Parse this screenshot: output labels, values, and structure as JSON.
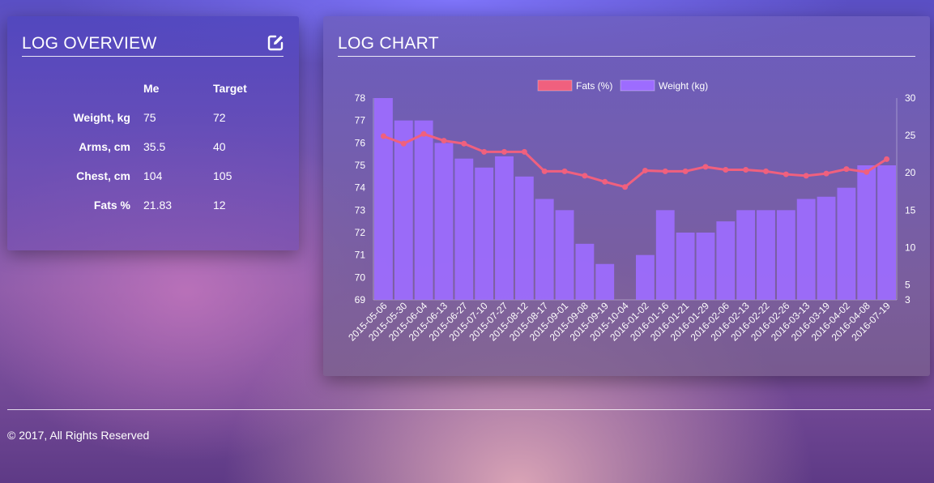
{
  "overview": {
    "title": "LOG OVERVIEW",
    "edit_icon": "edit-icon",
    "col_me": "Me",
    "col_target": "Target",
    "rows": [
      {
        "label": "Weight, kg",
        "me": "75",
        "target": "72"
      },
      {
        "label": "Arms, cm",
        "me": "35.5",
        "target": "40"
      },
      {
        "label": "Chest, cm",
        "me": "104",
        "target": "105"
      },
      {
        "label": "Fats %",
        "me": "21.83",
        "target": "12"
      }
    ]
  },
  "chart_panel": {
    "title": "LOG CHART"
  },
  "footer": {
    "text": "© 2017, All Rights Reserved"
  },
  "chart_data": {
    "type": "bar",
    "legend_position": "top",
    "categories": [
      "2015-05-06",
      "2015-05-30",
      "2015-06-04",
      "2015-06-13",
      "2015-06-27",
      "2015-07-10",
      "2015-07-27",
      "2015-08-12",
      "2015-08-17",
      "2015-09-01",
      "2015-09-08",
      "2015-09-19",
      "2015-10-04",
      "2016-01-02",
      "2016-01-16",
      "2016-01-21",
      "2016-01-29",
      "2016-02-06",
      "2016-02-13",
      "2016-02-22",
      "2016-02-26",
      "2016-03-13",
      "2016-03-19",
      "2016-04-02",
      "2016-04-08",
      "2016-07-19"
    ],
    "series": [
      {
        "name": "Fats (%)",
        "type": "line",
        "axis": "right",
        "color": "#f0607e",
        "values": [
          24.9,
          23.9,
          25.2,
          24.3,
          23.9,
          22.8,
          22.8,
          22.8,
          20.2,
          20.2,
          19.6,
          18.8,
          18.1,
          20.3,
          20.2,
          20.2,
          20.8,
          20.4,
          20.4,
          20.2,
          19.8,
          19.6,
          19.9,
          20.5,
          20.1,
          21.83
        ]
      },
      {
        "name": "Weight (kg)",
        "type": "bar",
        "axis": "left",
        "color": "#9d6cff",
        "values": [
          78,
          77,
          77,
          76,
          75.3,
          74.9,
          75.4,
          74.5,
          73.5,
          73,
          71.5,
          70.6,
          69,
          71,
          73,
          72,
          72,
          72.5,
          73,
          73,
          73,
          73.5,
          73.6,
          74,
          75,
          75
        ]
      }
    ],
    "y_left": {
      "min": 69,
      "max": 78,
      "ticks": [
        69,
        70,
        71,
        72,
        73,
        74,
        75,
        76,
        77,
        78
      ]
    },
    "y_right": {
      "min": 3,
      "max": 30,
      "ticks": [
        3,
        5,
        10,
        15,
        20,
        25,
        30
      ]
    }
  }
}
